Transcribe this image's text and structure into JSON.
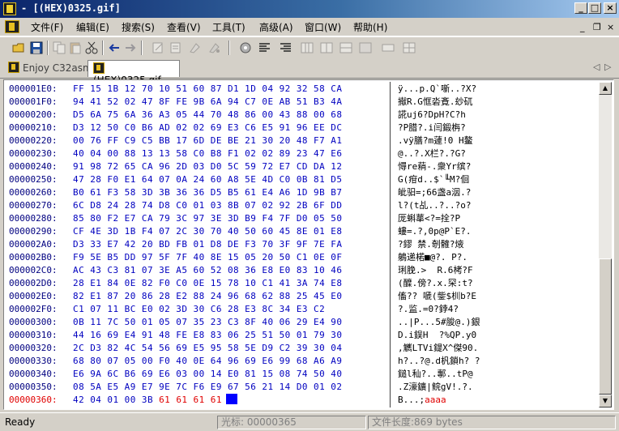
{
  "window": {
    "title": "- [(HEX)0325.gif]",
    "buttons": {
      "minimize": "_",
      "maximize": "□",
      "close": "×"
    }
  },
  "menubar": {
    "items": [
      "文件(F)",
      "编辑(E)",
      "搜索(S)",
      "查看(V)",
      "工具(T)",
      "高级(A)",
      "窗口(W)",
      "帮助(H)"
    ],
    "mdi_controls": [
      "_",
      "❐",
      "×"
    ]
  },
  "toolbar": {
    "icons": [
      "open-icon",
      "save-icon",
      "copy-icon",
      "paste-icon",
      "cut-icon",
      "undo-icon",
      "redo-icon",
      "edit-icon",
      "edit2-icon",
      "edit3-icon",
      "edit4-icon",
      "settings-icon",
      "align-left-icon",
      "align-right-icon",
      "columns-icon",
      "column-icon",
      "grid-icon"
    ]
  },
  "tabs": [
    {
      "label": "Enjoy C32asm",
      "active": false
    },
    {
      "label": "(HEX)0325.gif",
      "active": true
    }
  ],
  "tabnav": {
    "left": "◁",
    "right": "▷",
    "close": "×"
  },
  "hexview": {
    "rows": [
      {
        "addr": "000001E0:",
        "hex": "FF 15 1B 12 70 10 51 60 87 D1 1D 04 92 32 58 CA",
        "ascii": "ÿ...p.Q`噺..?X?"
      },
      {
        "addr": "000001F0:",
        "hex": "94 41 52 02 47 8F FE 9B 6A 94 C7 0E AB 51 B3 4A",
        "ascii": "擜R.G恇沯斍.玅矹"
      },
      {
        "addr": "00000200:",
        "hex": "D5 6A 75 6A 36 A3 05 44 70 48 86 00 43 88 00 68",
        "ascii": "誮uj6?DpH?C?h"
      },
      {
        "addr": "00000210:",
        "hex": "D3 12 50 C0 B6 AD 02 02 69 E3 C6 E5 91 96 EE DC",
        "ascii": "?P腊?.i闫鍛栴?"
      },
      {
        "addr": "00000220:",
        "hex": "00 76 FF C9 C5 BB 17 6D DE BE 21 30 20 48 F7 A1",
        "ascii": ".vÿ膳?m蘧!0 H鳌"
      },
      {
        "addr": "00000230:",
        "hex": "40 04 00 88 13 13 58 C0 B8 F1 02 02 89 23 47 E6",
        "ascii": "@..?.X栏?.?G?"
      },
      {
        "addr": "00000240:",
        "hex": "91 98 72 65 CA 96 2D 03 D0 5C 59 72 E7 CD DA 12",
        "ascii": "憳re蕱-.衆Yr缤?"
      },
      {
        "addr": "00000250:",
        "hex": "47 28 F0 E1 64 07 0A 24 60 A8 5E 4D C0 0B 81 D5",
        "ascii": "G(疳d..$`╙M?佪"
      },
      {
        "addr": "00000260:",
        "hex": "B0 61 F3 58 3D 3B 36 36 D5 B5 61 E4 A6 1D 9B B7",
        "ascii": "皉驲=;66盏a洇.?"
      },
      {
        "addr": "00000270:",
        "hex": "6C D8 24 28 74 D8 C0 01 03 8B 07 02 92 2B 6F DD",
        "ascii": "l?(t乩..?..?o?"
      },
      {
        "addr": "00000280:",
        "hex": "85 80 F2 E7 CA 79 3C 97 3E 3D B9 F4 7F D0 05 50",
        "ascii": "厐蝌蕐<?=拴?P"
      },
      {
        "addr": "00000290:",
        "hex": "CF 4E 3D 1B F4 07 2C 30 70 40 50 60 45 8E 01 E8",
        "ascii": "螻=.?,0p@P`E?."
      },
      {
        "addr": "000002A0:",
        "hex": "D3 33 E7 42 20 BD FB 01 D8 DE F3 70 3F 9F 7E FA",
        "ascii": "?鏐 禁.剞髉?焲"
      },
      {
        "addr": "000002B0:",
        "hex": "F9 5E B5 DD 97 5F 7F 40 8E 15 05 20 50 C1 0E 0F",
        "ascii": "鵢递楉■@?. P?."
      },
      {
        "addr": "000002C0:",
        "hex": "AC 43 C3 81 07 3E A5 60 52 08 36 E8 E0 83 10 46",
        "ascii": "琍脕.>  R.6栲?F"
      },
      {
        "addr": "000002D0:",
        "hex": "28 E1 84 0E 82 F0 C0 0E 15 78 10 C1 41 3A 74 E8",
        "ascii": "(醾.傍?.x.罙:t?"
      },
      {
        "addr": "000002E0:",
        "hex": "82 E1 87 20 86 28 E2 88 24 96 68 62 88 25 45 E0",
        "ascii": "傗?? 嗁(鈭$杊b?E"
      },
      {
        "addr": "000002F0:",
        "hex": "C1 07 11 BC E0 02 3D 30 C6 28 E3 8C 34 E3 C2",
        "ascii": "?.监.=0?鋍4?"
      },
      {
        "addr": "00000300:",
        "hex": "0B 11 7C 50 01 05 07 35 23 C3 8F 40 06 29 E4 90",
        "ascii": "..|P...5#脧@.)銀"
      },
      {
        "addr": "00000310:",
        "hex": "44 16 69 E4 91 48 FE E8 83 06 25 51 50 01 79 30",
        "ascii": "D.i鋘H  ?%QP.y0"
      },
      {
        "addr": "00000320:",
        "hex": "2C D3 82 4C 54 56 69 E5 95 58 5E D9 C2 39 30 04",
        "ascii": ",觽LTVi鍉X^傑90."
      },
      {
        "addr": "00000330:",
        "hex": "68 80 07 05 00 F0 40 0E 64 96 69 E6 99 68 A6 A9",
        "ascii": "h?..?@.d杋鎖h? ?"
      },
      {
        "addr": "00000340:",
        "hex": "E6 9A 6C B6 69 E6 03 00 14 E0 81 15 08 74 50 40",
        "ascii": "鎚l秈?..鄟..tP@"
      },
      {
        "addr": "00000350:",
        "hex": "08 5A E5 A9 E7 9E 7C F6 E9 67 56 21 14 D0 01 02",
        "ascii": ".Z濠鑛|鲩gV!.?."
      },
      {
        "addr": "00000360:",
        "hex": "42 04 01 00 3B",
        "hex_typed": "61 61 61 61",
        "ascii": "B...;",
        "ascii_typed": "aaaa",
        "current": true
      }
    ]
  },
  "statusbar": {
    "ready": "Ready",
    "cursor": "光标: 00000365",
    "filelength": "文件长度:869 bytes"
  }
}
